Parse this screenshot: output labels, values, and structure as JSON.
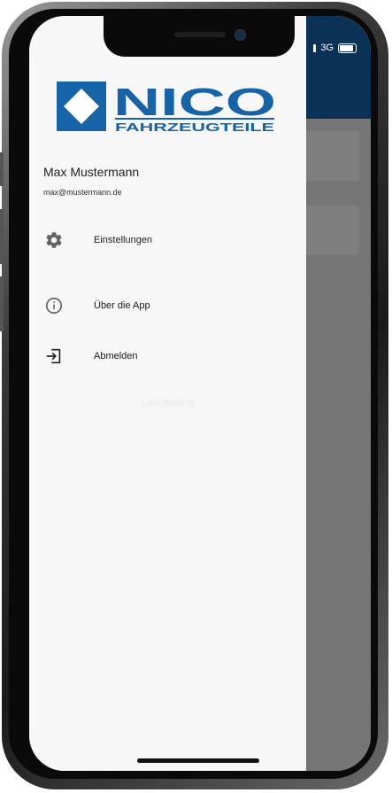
{
  "status_bar": {
    "network": "3G"
  },
  "brand": {
    "logo_primary": "NICO",
    "logo_secondary": "FAHRZEUGTEILE",
    "color": "#1763a8"
  },
  "user": {
    "name": "Max Mustermann",
    "email": "max@mustermann.de"
  },
  "menu": [
    {
      "label": "Einstellungen",
      "icon": "gear-icon"
    },
    {
      "label": "Über die App",
      "icon": "info-icon"
    },
    {
      "label": "Abmelden",
      "icon": "logout-icon"
    }
  ],
  "footer": {
    "version": "1.0.0 (build 6)"
  }
}
